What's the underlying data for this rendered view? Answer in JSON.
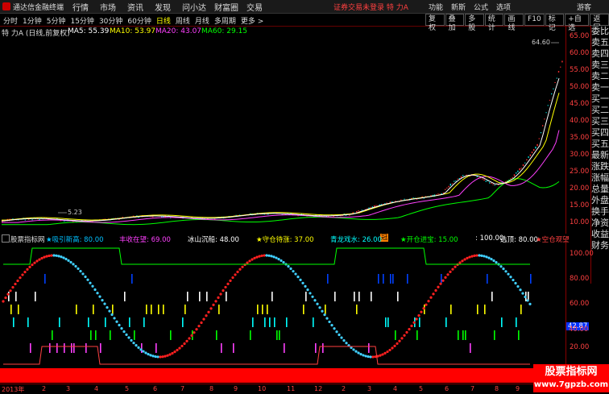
{
  "app": {
    "name": "通达信金融终端"
  },
  "menu": [
    "行情",
    "市场",
    "资讯",
    "发现",
    "问小达",
    "财富圈",
    "交易"
  ],
  "status_text": "证券交易未登录 特 力A",
  "right_menu": [
    "功能",
    "新斯",
    "公式",
    "选项"
  ],
  "guest": "游客",
  "periods": [
    "分时",
    "1分钟",
    "5分钟",
    "15分钟",
    "30分钟",
    "60分钟",
    "日线",
    "周线",
    "月线",
    "多周期",
    "更多 >"
  ],
  "active_period": "日线",
  "tools": [
    "复权",
    "叠加",
    "多股",
    "统计",
    "画线",
    "F10",
    "标记",
    "+自选",
    "返回"
  ],
  "indicator": {
    "stock": "特 力A (日线,前复权)",
    "ma5": "MA5: 55.39",
    "ma10": "MA10: 53.97",
    "ma20": "MA20: 43.07",
    "ma60": "MA60: 29.15"
  },
  "main_axis": [
    "65.00",
    "60.00",
    "55.00",
    "50.00",
    "45.00",
    "40.00",
    "35.00",
    "30.00",
    "25.00",
    "20.00",
    "15.00",
    "10.00",
    "5.00"
  ],
  "annotations": {
    "high": "64.60",
    "low": "5.23",
    "mark": "冠"
  },
  "side_tabs": [
    "委比",
    "卖五",
    "卖四",
    "卖三",
    "卖二",
    "卖一",
    "买一",
    "买二",
    "买三",
    "买四",
    "买五",
    "最新",
    "涨跌",
    "涨幅",
    "总量",
    "外盘",
    "换手",
    "净资",
    "收益",
    "财务"
  ],
  "sub_header": {
    "name": "股票指标网",
    "items": [
      {
        "label": "★吸引新高: 80.00",
        "color": "#00c0ff"
      },
      {
        "label": "丰收在望: 69.00",
        "color": "#ff40ff"
      },
      {
        "label": "冰山沉船: 48.00",
        "color": "#ffffff"
      },
      {
        "label": "★守仓待涨: 37.00",
        "color": "#ffff00"
      },
      {
        "label": "青龙戏水: 26.00",
        "color": "#00ffff"
      },
      {
        "label": "★开仓进宝: 15.00",
        "color": "#00ff00"
      },
      {
        "label": ": 100.00",
        "color": "#ffffff"
      },
      {
        "label": "选顶: 80.00",
        "color": "#ffffff"
      },
      {
        "label": "★空仓观望",
        "color": "#ff4040"
      }
    ]
  },
  "sub_axis": [
    "100.00",
    "80.00",
    "60.00",
    "40.00",
    "20.00"
  ],
  "sub_marker": "42.87",
  "time_axis": [
    "2013年",
    "2",
    "3",
    "4",
    "5",
    "6",
    "7",
    "8",
    "9",
    "10",
    "11",
    "12",
    "2",
    "3",
    "4",
    "5",
    "6",
    "7",
    "8",
    "9",
    "10",
    "11"
  ],
  "watermark": {
    "line1": "股票指标网",
    "line2": "www.7gpzb.com"
  },
  "colors": {
    "accent_red": "#ff0000",
    "ma5": "#ffffff",
    "ma10": "#ffff00",
    "ma20": "#ff40ff",
    "ma60": "#00ff00"
  }
}
